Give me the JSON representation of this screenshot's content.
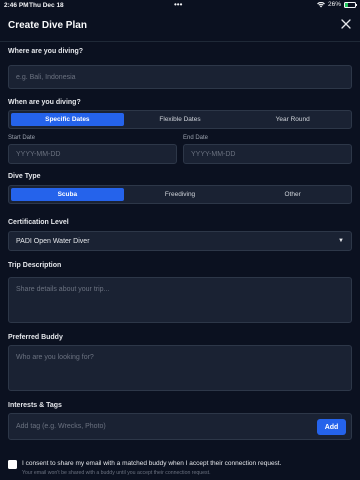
{
  "status_bar": {
    "time": "2:46 PM",
    "date": "Thu Dec 18",
    "dots": "•••",
    "battery_percent": "26%",
    "battery_level": 0.26
  },
  "header": {
    "title": "Create Dive Plan"
  },
  "location": {
    "label": "Where are you diving?",
    "placeholder": "e.g. Bali, Indonesia"
  },
  "when": {
    "label": "When are you diving?",
    "options": [
      "Specific Dates",
      "Flexible Dates",
      "Year Round"
    ],
    "selected": "Specific Dates",
    "start_label": "Start Date",
    "end_label": "End Date",
    "date_placeholder": "YYYY-MM-DD"
  },
  "dive_type": {
    "label": "Dive Type",
    "options": [
      "Scuba",
      "Freediving",
      "Other"
    ],
    "selected": "Scuba"
  },
  "certification": {
    "label": "Certification Level",
    "value": "PADI Open Water Diver"
  },
  "trip": {
    "label": "Trip Description",
    "placeholder": "Share details about your trip..."
  },
  "buddy": {
    "label": "Preferred Buddy",
    "placeholder": "Who are you looking for?"
  },
  "tags": {
    "label": "Interests & Tags",
    "placeholder": "Add tag (e.g. Wrecks, Photo)",
    "add_label": "Add"
  },
  "consent": {
    "checked": false,
    "text": "I consent to share my email with a matched buddy when I accept their connection request.",
    "note": "Your email won't be shared with a buddy until you accept their connection request."
  },
  "colors": {
    "background": "#0b1120",
    "field": "#1a2233",
    "accent": "#2563eb"
  }
}
